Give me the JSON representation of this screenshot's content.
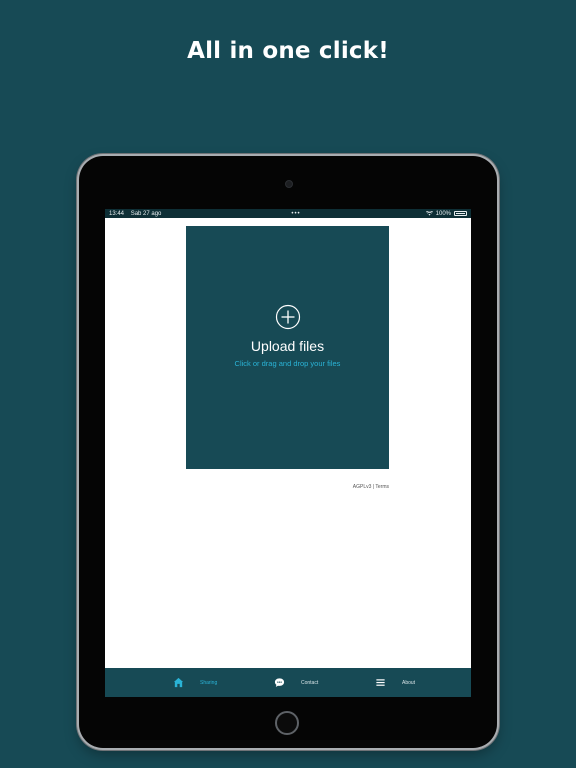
{
  "headline": "All in one click!",
  "status_bar": {
    "time": "13:44",
    "date": "Sab 27 ago",
    "battery": "100%"
  },
  "upload": {
    "title": "Upload files",
    "subtitle": "Click or drag and drop your files"
  },
  "footer": {
    "links": "AGPLv3 | Terms"
  },
  "tabs": [
    {
      "label": "Sharing",
      "icon": "home-icon",
      "active": true
    },
    {
      "label": "Contact",
      "icon": "chat-bubble-icon",
      "active": false
    },
    {
      "label": "About",
      "icon": "menu-icon",
      "active": false
    }
  ],
  "colors": {
    "background": "#174a55",
    "accent": "#2ab3d6",
    "screen": "#ffffff"
  }
}
